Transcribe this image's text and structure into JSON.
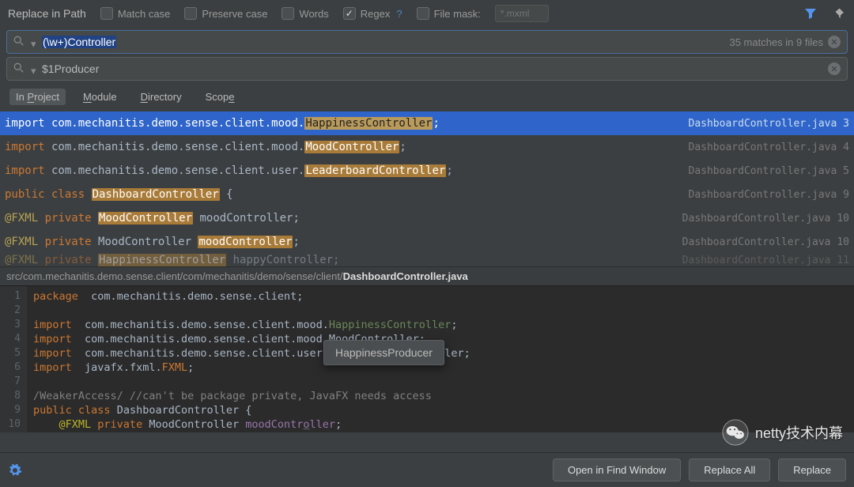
{
  "header": {
    "title": "Replace in Path",
    "options": {
      "match_case": {
        "label": "Match case",
        "checked": false
      },
      "preserve_case": {
        "label": "Preserve case",
        "checked": false
      },
      "words": {
        "label": "Words",
        "checked": false
      },
      "regex": {
        "label": "Regex",
        "checked": true,
        "help": "?"
      },
      "file_mask": {
        "label": "File mask:",
        "checked": false,
        "placeholder": "*.mxml"
      }
    }
  },
  "search": {
    "value": "(\\w+)Controller",
    "match_info": "35 matches in 9 files"
  },
  "replace": {
    "value": "$1Producer"
  },
  "scope": {
    "tabs": [
      {
        "label_pre": "In ",
        "mn": "P",
        "label_post": "roject",
        "active": true
      },
      {
        "label_pre": "",
        "mn": "M",
        "label_post": "odule",
        "active": false
      },
      {
        "label_pre": "",
        "mn": "D",
        "label_post": "irectory",
        "active": false
      },
      {
        "label_pre": "Scop",
        "mn": "e",
        "label_post": "",
        "active": false
      }
    ]
  },
  "results": [
    {
      "selected": true,
      "kw": "import",
      "pre": " com.mechanitis.demo.sense.client.mood.",
      "hl": "HappinessController",
      "post": ";",
      "file": "DashboardController.java",
      "line": "3"
    },
    {
      "selected": false,
      "kw": "import",
      "pre": " com.mechanitis.demo.sense.client.mood.",
      "hl": "MoodController",
      "post": ";",
      "file": "DashboardController.java",
      "line": "4"
    },
    {
      "selected": false,
      "kw": "import",
      "pre": " com.mechanitis.demo.sense.client.user.",
      "hl": "LeaderboardController",
      "post": ";",
      "file": "DashboardController.java",
      "line": "5"
    },
    {
      "selected": false,
      "kw": "public class ",
      "pre": "",
      "hl": "DashboardController",
      "post": " {",
      "file": "DashboardController.java",
      "line": "9"
    },
    {
      "selected": false,
      "kw2": "@FXML private ",
      "pre": "",
      "hl": "MoodController",
      "post": " moodController;",
      "file": "DashboardController.java",
      "line": "10"
    },
    {
      "selected": false,
      "kw2": "@FXML private ",
      "pre": "MoodController ",
      "hl": "moodController",
      "post": ";",
      "file": "DashboardController.java",
      "line": "10"
    }
  ],
  "cut_row": {
    "kw2": "@FXML private ",
    "hl": "HappinessController",
    "post": " happyController;",
    "file": "DashboardController.java",
    "line": "11"
  },
  "path": {
    "prefix": "src/com.mechanitis.demo.sense.client/com/mechanitis/demo/sense/client/",
    "file": "DashboardController.java"
  },
  "code": {
    "lines": [
      "1",
      "2",
      "3",
      "4",
      "5",
      "6",
      "7",
      "8",
      "9",
      "10"
    ],
    "pkg": "package",
    "pkg_name": "com.mechanitis.demo.sense.client",
    "imp": "import",
    "imp1a": "com.mechanitis.demo.sense.client.mood.",
    "imp1b": "HappinessController",
    "imp2": "com.mechanitis.demo.sense.client.mood.MoodC",
    "imp2u": "o",
    "imp2c": "ntroller",
    "imp3": "com.mechanitis.demo.sense.client.user.LeaderboardC",
    "imp3u": "o",
    "imp3c": "ntroller",
    "imp4a": "javafx.fxml.",
    "imp4b": "FXML",
    "cmt1": "/WeakerAccess/",
    "cmt2": " //can't be package private, JavaFX needs access",
    "pub": "public ",
    "cls": "class ",
    "cls_name": "DashboardController {",
    "fxml": "@FXML ",
    "priv": "private ",
    "mood_t": "MoodController ",
    "mood_u": "moodContr",
    "mood_o": "o",
    "mood_r": "ller",
    "semi": ";"
  },
  "tooltip": "HappinessProducer",
  "footer": {
    "open": "Open in Find Window",
    "replace_all": "Replace All",
    "replace": "Replace"
  },
  "watermark": "netty技术内幕"
}
